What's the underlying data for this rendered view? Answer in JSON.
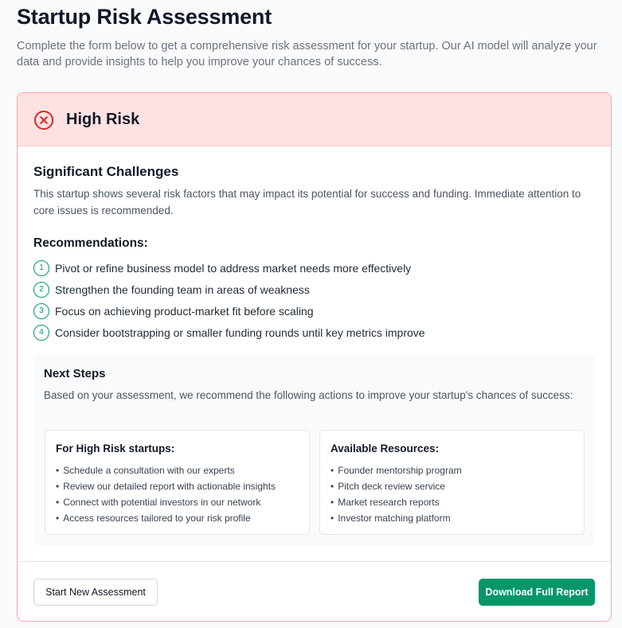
{
  "page": {
    "title": "Startup Risk Assessment",
    "subtitle": "Complete the form below to get a comprehensive risk assessment for your startup. Our AI model will analyze your data and provide insights to help you improve your chances of success."
  },
  "result": {
    "risk_level": "High Risk",
    "risk_icon": "x-circle-icon",
    "challenge_title": "Significant Challenges",
    "challenge_description": "This startup shows several risk factors that may impact its potential for success and funding. Immediate attention to core issues is recommended."
  },
  "recommendations": {
    "title": "Recommendations:",
    "items": [
      {
        "num": "1",
        "text": "Pivot or refine business model to address market needs more effectively"
      },
      {
        "num": "2",
        "text": "Strengthen the founding team in areas of weakness"
      },
      {
        "num": "3",
        "text": "Focus on achieving product-market fit before scaling"
      },
      {
        "num": "4",
        "text": "Consider bootstrapping or smaller funding rounds until key metrics improve"
      }
    ]
  },
  "next_steps": {
    "title": "Next Steps",
    "description": "Based on your assessment, we recommend the following actions to improve your startup's chances of success:",
    "left_card": {
      "title": "For High Risk startups:",
      "items": [
        "Schedule a consultation with our experts",
        "Review our detailed report with actionable insights",
        "Connect with potential investors in our network",
        "Access resources tailored to your risk profile"
      ]
    },
    "right_card": {
      "title": "Available Resources:",
      "items": [
        "Founder mentorship program",
        "Pitch deck review service",
        "Market research reports",
        "Investor matching platform"
      ]
    }
  },
  "footer": {
    "new_assessment_label": "Start New Assessment",
    "download_label": "Download Full Report"
  },
  "colors": {
    "danger": "#dc2626",
    "danger_bg": "#fee2e2",
    "accent": "#059669"
  }
}
